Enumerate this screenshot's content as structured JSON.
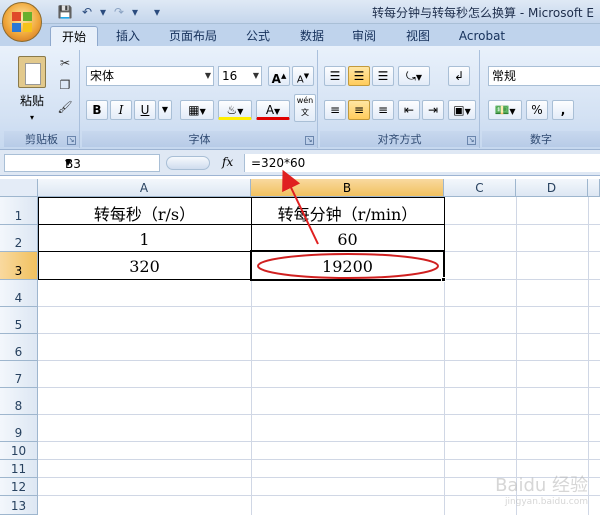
{
  "window": {
    "title": "转每分钟与转每秒怎么换算 - Microsoft E"
  },
  "ribbon": {
    "tabs": [
      "开始",
      "插入",
      "页面布局",
      "公式",
      "数据",
      "审阅",
      "视图",
      "Acrobat"
    ],
    "active_tab": "开始",
    "groups": {
      "clipboard": {
        "label": "剪贴板",
        "paste_label": "粘贴"
      },
      "font": {
        "label": "字体",
        "font_name": "宋体",
        "font_size": "16",
        "bold": "B",
        "italic": "I",
        "underline": "U",
        "grow": "A",
        "shrink": "A",
        "color_a": "A",
        "phonetic": "wén"
      },
      "alignment": {
        "label": "对齐方式"
      },
      "number": {
        "label": "数字",
        "format": "常规",
        "percent": "%",
        "comma": ","
      }
    }
  },
  "formula_bar": {
    "name_box": "B3",
    "fx": "fx",
    "formula": "=320*60"
  },
  "grid": {
    "columns": [
      "A",
      "B",
      "C",
      "D"
    ],
    "selected_column": "B",
    "rows": [
      "1",
      "2",
      "3",
      "4",
      "5",
      "6",
      "7",
      "8",
      "9",
      "10",
      "11",
      "12",
      "13"
    ],
    "selected_row": "3",
    "cells": {
      "A1": "转每秒（r/s）",
      "B1": "转每分钟（r/min）",
      "A2": "1",
      "B2": "60",
      "A3": "320",
      "B3": "19200"
    }
  },
  "annotation": {
    "arrow_color": "#e02020",
    "ellipse_color": "#d02020"
  },
  "colors": {
    "selected_header": "#f1c15f",
    "ribbon_blue": "#bfd3ec"
  }
}
